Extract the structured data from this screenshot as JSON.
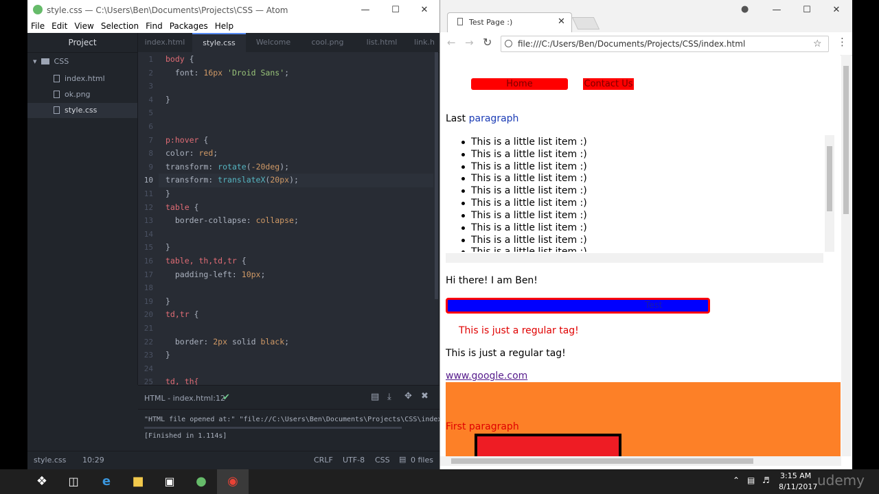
{
  "atom": {
    "title": "style.css — C:\\Users\\Ben\\Documents\\Projects\\CSS — Atom",
    "menu": [
      "File",
      "Edit",
      "View",
      "Selection",
      "Find",
      "Packages",
      "Help"
    ],
    "tree": {
      "header": "Project",
      "folder": "CSS",
      "files": [
        "index.html",
        "ok.png",
        "style.css"
      ],
      "selected": "style.css"
    },
    "tabs": [
      "index.html",
      "style.css",
      "Welcome",
      "cool.png",
      "list.html",
      "link.h"
    ],
    "active_tab": "style.css",
    "line_numbers": [
      "1",
      "2",
      "3",
      "4",
      "5",
      "6",
      "7",
      "8",
      "9",
      "10",
      "11",
      "12",
      "13",
      "14",
      "15",
      "16",
      "17",
      "18",
      "19",
      "20",
      "21",
      "22",
      "23",
      "24",
      "25"
    ],
    "current_line": "10",
    "bottom_panel": {
      "title": "HTML - index.html:12",
      "log1": "\"HTML file opened at:\" \"file://C:\\Users\\Ben\\Documents\\Projects\\CSS\\index",
      "log2": "[Finished in 1.114s]"
    },
    "status": {
      "file": "style.css",
      "cursor": "10:29",
      "line_ending": "CRLF",
      "encoding": "UTF-8",
      "grammar": "CSS",
      "files": "0 files"
    }
  },
  "code": {
    "l1a": "body",
    "l1b": " {",
    "l2a": "  font: ",
    "l2b": "16px",
    "l2c": " ",
    "l2d": "'Droid Sans'",
    "l2e": ";",
    "l4": "}",
    "l7a": "p:hover",
    "l7b": " {",
    "l8a": "color: ",
    "l8b": "red",
    "l8c": ";",
    "l9a": "transform: ",
    "l9b": "rotate",
    "l9c": "(",
    "l9d": "-20deg",
    "l9e": ");",
    "l10a": "transform: ",
    "l10b": "translateX",
    "l10c": "(",
    "l10d": "20px",
    "l10e": ");",
    "l11": "}",
    "l12a": "table",
    "l12b": " {",
    "l13a": "  border-collapse: ",
    "l13b": "collapse",
    "l13c": ";",
    "l15": "}",
    "l16a": "table, th,td,tr",
    "l16b": " {",
    "l17a": "  padding-left: ",
    "l17b": "10px",
    "l17c": ";",
    "l19": "}",
    "l20a": "td,tr",
    "l20b": " {",
    "l22a": "  border: ",
    "l22b": "2px",
    "l22c": " solid ",
    "l22d": "black",
    "l22e": ";",
    "l23": "}",
    "l25": "td, th{"
  },
  "browser": {
    "tab_title": "Test Page :)",
    "url": "file:///C:/Users/Ben/Documents/Projects/CSS/index.html",
    "page": {
      "nav_home": "Home",
      "nav_contact": "Contact Us",
      "last_para": "Last",
      "last_para_link": "paragraph",
      "list_items": [
        "This is a little list item :)",
        "This is a little list item :)",
        "This is a little list item :)",
        "This is a little list item :)",
        "This is a little list item :)",
        "This is a little list item :)",
        "This is a little list item :)",
        "This is a little list item :)",
        "This is a little list item :)",
        "This is a little list item :)"
      ],
      "greeting": "Hi there! I am Ben!",
      "test_button": "Test",
      "regular_red": "This is just a regular tag!",
      "regular": "This is just a regular tag!",
      "google_link": "www.google.com",
      "first_para": "First paragraph"
    }
  },
  "taskbar": {
    "time": "3:15 AM",
    "date": "8/11/2017",
    "watermark": "udemy"
  },
  "colors": {
    "atom_bg": "#282c34",
    "accent": "#568af2",
    "nav_red": "#ff0000",
    "blue": "#0000ff",
    "orange": "#fd8027",
    "google_link": "#551a8b"
  }
}
